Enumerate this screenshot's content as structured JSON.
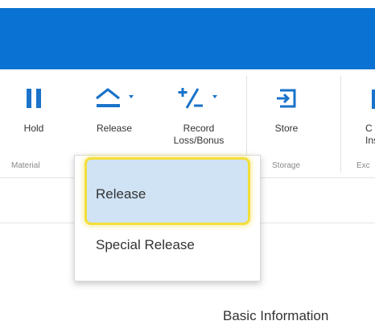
{
  "ribbon": {
    "buttons": [
      {
        "label": "Hold",
        "icon": "pause-icon"
      },
      {
        "label": "Release",
        "icon": "release-icon"
      },
      {
        "label": "Record\nLoss/Bonus",
        "icon": "plus-minus-icon"
      },
      {
        "label": "Store",
        "icon": "store-icon"
      },
      {
        "label": "C\nIns",
        "icon": "partial-icon"
      }
    ],
    "groups": {
      "material": "Material",
      "storage": "Storage",
      "partial": "Exc"
    }
  },
  "dropdown": {
    "items": [
      {
        "label": "Release",
        "selected": true
      },
      {
        "label": "Special Release",
        "selected": false
      }
    ]
  },
  "content": {
    "section_title": "Basic Information"
  },
  "colors": {
    "header_blue": "#0a72d2",
    "icon_blue": "#1a73c9",
    "highlight_bg": "#cfe3f5",
    "highlight_border": "#f3de3a"
  }
}
